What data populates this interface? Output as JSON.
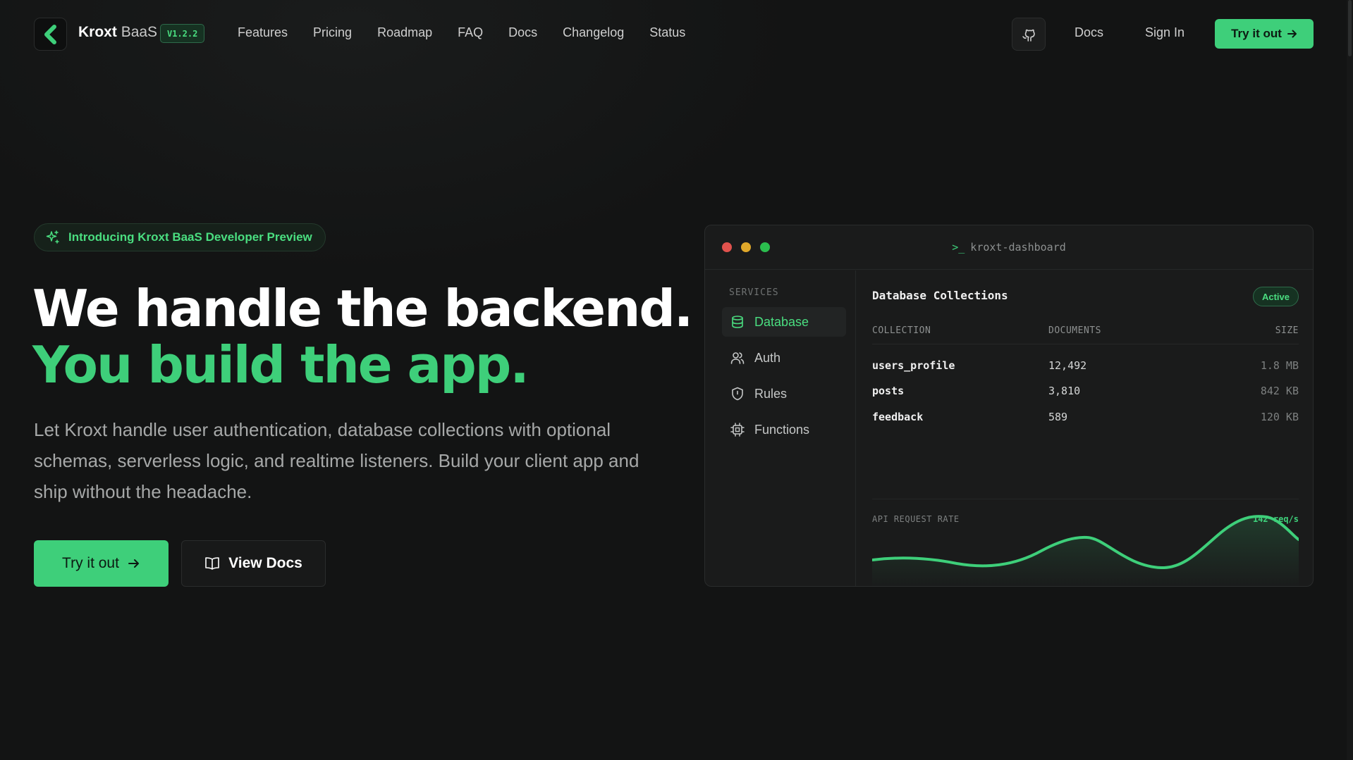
{
  "nav": {
    "brand_bold": "Kroxt",
    "brand_light": "BaaS",
    "version": "V1.2.2",
    "links": [
      "Features",
      "Pricing",
      "Roadmap",
      "FAQ",
      "Docs",
      "Changelog",
      "Status"
    ],
    "docs": "Docs",
    "sign_in": "Sign In",
    "try": "Try it out"
  },
  "hero": {
    "pill": "Introducing Kroxt BaaS Developer Preview",
    "headline_1": "We handle the backend.",
    "headline_2": "You build the app.",
    "lead": "Let Kroxt handle user authentication, database collections with optional schemas, serverless logic, and realtime listeners. Build your client app and ship without the headache.",
    "cta_primary": "Try it out",
    "cta_secondary": "View Docs"
  },
  "dashboard": {
    "window_title": "kroxt-dashboard",
    "prompt": ">_",
    "sidebar_label": "SERVICES",
    "sidebar_items": [
      {
        "label": "Database",
        "icon": "database-icon",
        "active": true
      },
      {
        "label": "Auth",
        "icon": "users-icon",
        "active": false
      },
      {
        "label": "Rules",
        "icon": "shield-icon",
        "active": false
      },
      {
        "label": "Functions",
        "icon": "cpu-icon",
        "active": false
      }
    ],
    "title": "Database Collections",
    "status": "Active",
    "columns": [
      "COLLECTION",
      "DOCUMENTS",
      "SIZE"
    ],
    "rows": [
      {
        "collection": "users_profile",
        "documents": "12,492",
        "size": "1.8 MB"
      },
      {
        "collection": "posts",
        "documents": "3,810",
        "size": "842 KB"
      },
      {
        "collection": "feedback",
        "documents": "589",
        "size": "120 KB"
      }
    ],
    "chart_label": "API REQUEST RATE",
    "chart_rate": "142 req/s"
  },
  "colors": {
    "accent": "#3ecf7a",
    "accent_text": "#4ade80",
    "background": "#131414",
    "panel": "#1a1b1b",
    "dot_red": "#e0524d",
    "dot_yellow": "#e0a82a",
    "dot_green": "#2bbd4e"
  }
}
